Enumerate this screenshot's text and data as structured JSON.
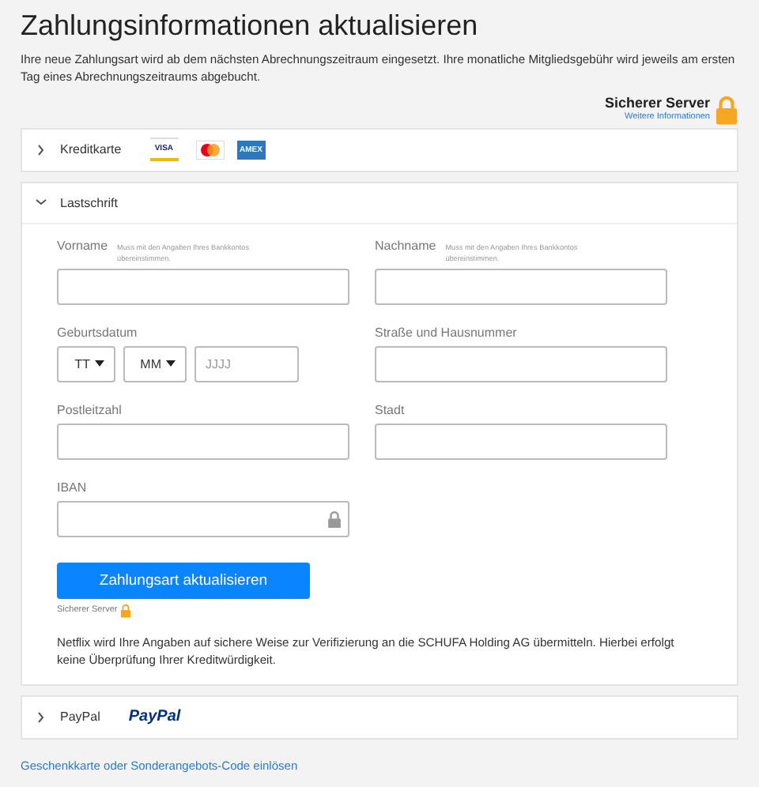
{
  "title": "Zahlungsinformationen aktualisieren",
  "intro": "Ihre neue Zahlungsart wird ab dem nächsten Abrechnungszeitraum eingesetzt. Ihre monatliche Mitgliedsgebühr wird jeweils am ersten Tag eines Abrechnungszeitraums abgebucht.",
  "secure_server": {
    "label": "Sicherer Server",
    "link": "Weitere Informationen"
  },
  "methods": [
    {
      "kind": "card",
      "label": "Kreditkarte",
      "expanded": false,
      "logos": [
        {
          "kind": "visa",
          "text": "VISA"
        },
        {
          "kind": "mastercard"
        },
        {
          "kind": "amex",
          "text": "AMEX"
        }
      ]
    },
    {
      "kind": "debit",
      "label": "Lastschrift",
      "expanded": true,
      "form": {
        "rows": [
          [
            {
              "kind": "text",
              "label": "Vorname",
              "hint": "Muss mit den Angaben Ihres Bankkontos übereinstimmen."
            },
            {
              "kind": "text",
              "label": "Nachname",
              "hint": "Muss mit den Angaben Ihres Bankkontos übereinstimmen."
            }
          ],
          [
            {
              "kind": "date",
              "label": "Geburtsdatum",
              "parts": [
                {
                  "kind": "select",
                  "value": "TT"
                },
                {
                  "kind": "select",
                  "value": "MM"
                },
                {
                  "kind": "input",
                  "placeholder": "JJJJ"
                }
              ]
            },
            {
              "kind": "text",
              "label": "Straße und Hausnummer"
            }
          ],
          [
            {
              "kind": "text",
              "label": "Postleitzahl"
            },
            {
              "kind": "text",
              "label": "Stadt"
            }
          ],
          [
            {
              "kind": "secure",
              "label": "IBAN"
            }
          ]
        ],
        "submit": "Zahlungsart aktualisieren",
        "secure_note": "Sicherer Server",
        "notice": "Netflix wird Ihre Angaben auf sichere Weise zur Verifizierung an die SCHUFA Holding AG übermitteln. Hierbei erfolgt keine Überprüfung Ihrer Kreditwürdigkeit."
      }
    },
    {
      "kind": "paypal",
      "label": "PayPal",
      "expanded": false,
      "logos": [
        {
          "kind": "paypal",
          "text": "PayPal"
        }
      ]
    }
  ],
  "gift_link": "Geschenkkarte oder Sonderangebots-Code einlösen"
}
